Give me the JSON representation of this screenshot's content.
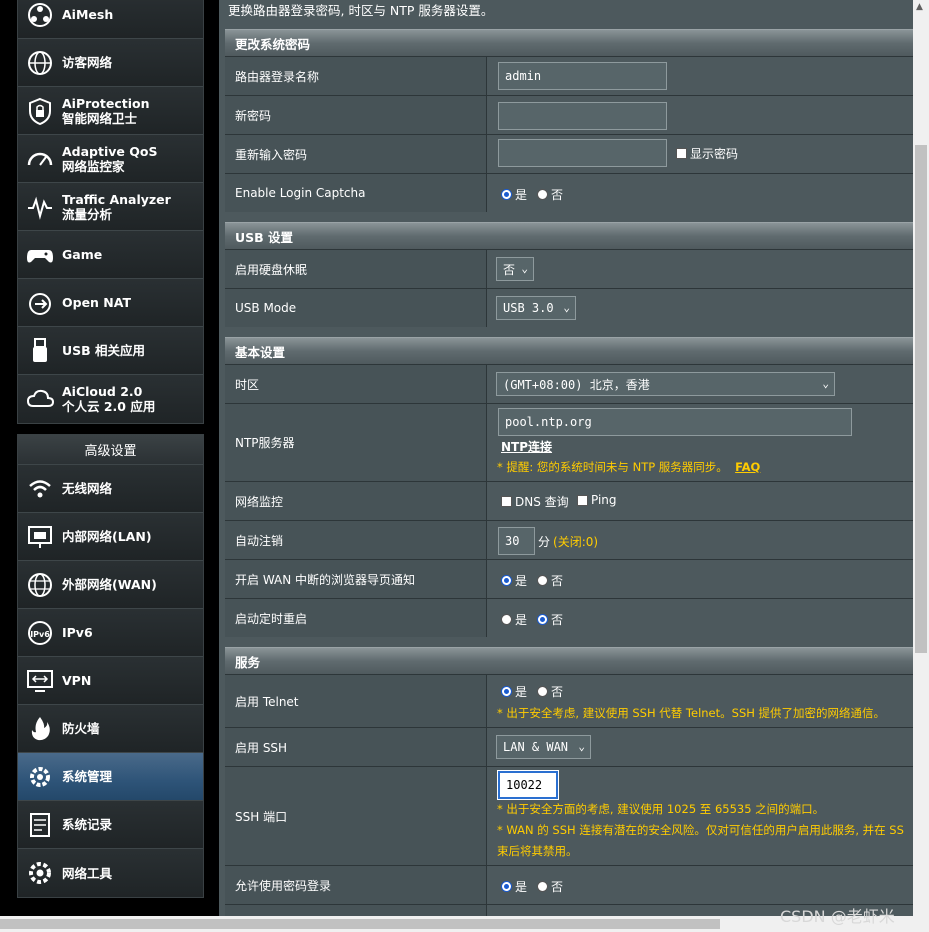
{
  "sidebar": {
    "top_items": [
      {
        "label": "AiMesh",
        "icon": "mesh-icon"
      },
      {
        "label": "访客网络",
        "icon": "globe-icon"
      },
      {
        "label": "AiProtection\n智能网络卫士",
        "icon": "shield-lock-icon"
      },
      {
        "label": "Adaptive QoS\n网络监控家",
        "icon": "speedometer-icon"
      },
      {
        "label": "Traffic Analyzer\n流量分析",
        "icon": "traffic-wave-icon"
      },
      {
        "label": "Game",
        "icon": "gamepad-icon"
      },
      {
        "label": "Open NAT",
        "icon": "open-nat-icon"
      },
      {
        "label": "USB 相关应用",
        "icon": "usb-icon"
      },
      {
        "label": "AiCloud 2.0\n个人云 2.0 应用",
        "icon": "cloud-icon"
      }
    ],
    "advanced_header": "高级设置",
    "advanced_items": [
      {
        "label": "无线网络",
        "icon": "wifi-icon"
      },
      {
        "label": "内部网络(LAN)",
        "icon": "lan-icon"
      },
      {
        "label": "外部网络(WAN)",
        "icon": "wan-globe-icon"
      },
      {
        "label": "IPv6",
        "icon": "ipv6-icon"
      },
      {
        "label": "VPN",
        "icon": "vpn-icon"
      },
      {
        "label": "防火墙",
        "icon": "firewall-icon"
      },
      {
        "label": "系统管理",
        "icon": "gear-person-icon"
      },
      {
        "label": "系统记录",
        "icon": "log-icon"
      },
      {
        "label": "网络工具",
        "icon": "tools-gear-icon"
      }
    ]
  },
  "main": {
    "intro": "更换路由器登录密码, 时区与 NTP 服务器设置。",
    "sections": {
      "password": "更改系统密码",
      "usb": "USB 设置",
      "basic": "基本设置",
      "service": "服务"
    },
    "password": {
      "login_name_label": "路由器登录名称",
      "login_name_value": "admin",
      "new_pw_label": "新密码",
      "new_pw_value": "",
      "retype_pw_label": "重新输入密码",
      "retype_pw_value": "",
      "show_pw_label": "显示密码",
      "captcha_label": "Enable Login Captcha",
      "yes": "是",
      "no": "否"
    },
    "usb": {
      "hdd_sleep_label": "启用硬盘休眠",
      "hdd_sleep_value": "否",
      "usb_mode_label": "USB Mode",
      "usb_mode_value": "USB 3.0"
    },
    "basic": {
      "tz_label": "时区",
      "tz_value": "(GMT+08:00) 北京，香港",
      "ntp_label": "NTP服务器",
      "ntp_value": "pool.ntp.org",
      "ntp_link": "NTP连接",
      "ntp_hint": "* 提醒: 您的系统时间未与 NTP 服务器同步。",
      "faq": "FAQ",
      "monitor_label": "网络监控",
      "dns_query": "DNS 查询",
      "ping": "Ping",
      "logout_label": "自动注销",
      "logout_value": "30",
      "logout_unit": "分",
      "logout_hint": "(关闭:0)",
      "wan_notify_label": "开启 WAN 中断的浏览器导页通知",
      "reboot_label": "启动定时重启"
    },
    "service": {
      "telnet_label": "启用 Telnet",
      "telnet_hint": "* 出于安全考虑, 建议使用 SSH 代替 Telnet。SSH 提供了加密的网络通信。",
      "ssh_label": "启用 SSH",
      "ssh_value": "LAN & WAN",
      "ssh_port_label": "SSH 端口",
      "ssh_port_value": "10022",
      "ssh_port_hint1": "* 出于安全方面的考虑, 建议使用 1025 至 65535 之间的端口。",
      "ssh_port_hint2": "* WAN 的 SSH 连接有潜在的安全风险。仅对可信任的用户启用此服务, 并在 SS",
      "ssh_port_hint3": "束后将其禁用。",
      "pw_login_label": "允许使用密码登录"
    }
  },
  "watermark": "CSDN @老虾米"
}
